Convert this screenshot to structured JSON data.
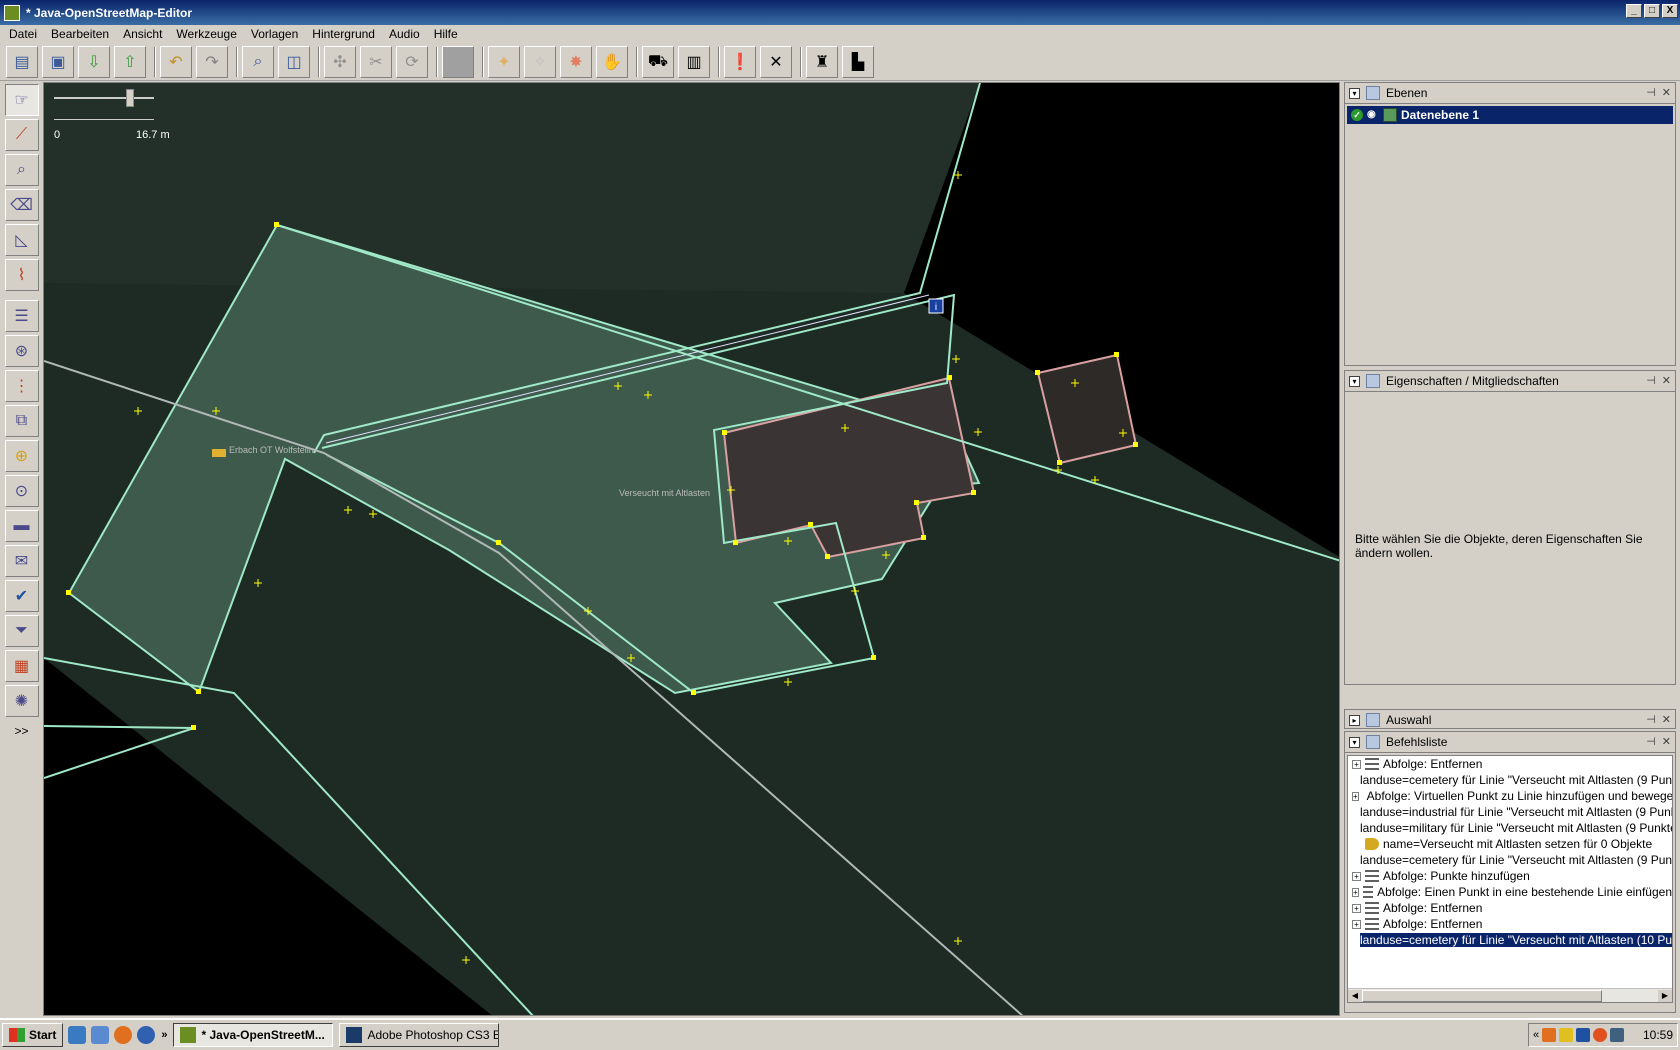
{
  "window": {
    "title": "* Java-OpenStreetMap-Editor",
    "btn_min": "_",
    "btn_max": "□",
    "btn_close": "X"
  },
  "menu": {
    "items": [
      "Datei",
      "Bearbeiten",
      "Ansicht",
      "Werkzeuge",
      "Vorlagen",
      "Hintergrund",
      "Audio",
      "Hilfe"
    ]
  },
  "toolbar": {
    "icons": [
      "open-file-icon",
      "save-icon",
      "download-icon",
      "upload-icon",
      "undo-icon",
      "redo-icon",
      "preferences-icon",
      "info-icon",
      "combine-way-icon",
      "split-way-icon",
      "refresh-icon",
      "grid-icon",
      "node-icon",
      "waypoint-icon",
      "delete-icon",
      "hand-icon",
      "car-icon",
      "bus-icon",
      "warning-icon",
      "cross-icon",
      "castle-icon",
      "factory-icon"
    ]
  },
  "left_tools": {
    "icons": [
      "select-icon",
      "draw-icon",
      "zoom-icon",
      "delete-icon",
      "extrude-icon",
      "improve-way-icon",
      "layers-icon",
      "tag-icon",
      "selection-list-icon",
      "relation-icon",
      "history-icon",
      "conflict-icon",
      "filter-icon",
      "message-icon",
      "validate-icon",
      "funnel-icon",
      "package-icon",
      "palette-icon"
    ],
    "more_label": ">>"
  },
  "map": {
    "scale_left": "0",
    "scale_right": "16.7 m",
    "label_poi": "Erbach OT Wolfsteiin",
    "label_area": "Verseucht mit Altlasten",
    "sign_text": "i"
  },
  "panels": {
    "layers": {
      "title": "Ebenen",
      "items": [
        {
          "name": "Datenebene 1"
        }
      ]
    },
    "properties": {
      "title": "Eigenschaften / Mitgliedschaften",
      "message": "Bitte wählen Sie die Objekte, deren Eigenschaften Sie ändern wollen."
    },
    "selection": {
      "title": "Auswahl"
    },
    "commands": {
      "title": "Befehlsliste",
      "rows": [
        {
          "expandable": true,
          "icon": "sequence",
          "text": "Abfolge: Entfernen"
        },
        {
          "expandable": false,
          "icon": "tag",
          "text": "landuse=cemetery für Linie \"Verseucht mit Altlasten (9 Punk"
        },
        {
          "expandable": true,
          "icon": "sequence",
          "text": "Abfolge: Virtuellen Punkt zu Linie hinzufügen und bewegen"
        },
        {
          "expandable": false,
          "icon": "tag",
          "text": "landuse=industrial für Linie \"Verseucht mit Altlasten (9 Punk"
        },
        {
          "expandable": false,
          "icon": "tag",
          "text": "landuse=military für Linie \"Verseucht mit Altlasten (9 Punkte"
        },
        {
          "expandable": false,
          "icon": "tag",
          "text": "name=Verseucht mit Altlasten setzen für 0 Objekte"
        },
        {
          "expandable": false,
          "icon": "tag",
          "text": "landuse=cemetery für Linie \"Verseucht mit Altlasten (9 Punk"
        },
        {
          "expandable": true,
          "icon": "sequence",
          "text": "Abfolge: Punkte hinzufügen"
        },
        {
          "expandable": true,
          "icon": "sequence",
          "text": "Abfolge: Einen Punkt in eine bestehende Linie einfügen"
        },
        {
          "expandable": true,
          "icon": "sequence",
          "text": "Abfolge: Entfernen"
        },
        {
          "expandable": true,
          "icon": "sequence",
          "text": "Abfolge: Entfernen"
        },
        {
          "expandable": false,
          "icon": "tag",
          "text": "landuse=cemetery für Linie \"Verseucht mit Altlasten (10 Pun",
          "selected": true
        }
      ]
    }
  },
  "taskbar": {
    "start": "Start",
    "more": "»",
    "tasks": [
      {
        "label": "* Java-OpenStreetM...",
        "active": true
      },
      {
        "label": "Adobe Photoshop CS3 E...",
        "active": false
      }
    ],
    "tray_more": "«",
    "clock": "10:59"
  },
  "colors": {
    "titlebar": "#0a246a",
    "area_fill": "#3d5a4c",
    "way": "#9fe8c8",
    "node": "#ffff00",
    "building": "#2d2a28"
  }
}
